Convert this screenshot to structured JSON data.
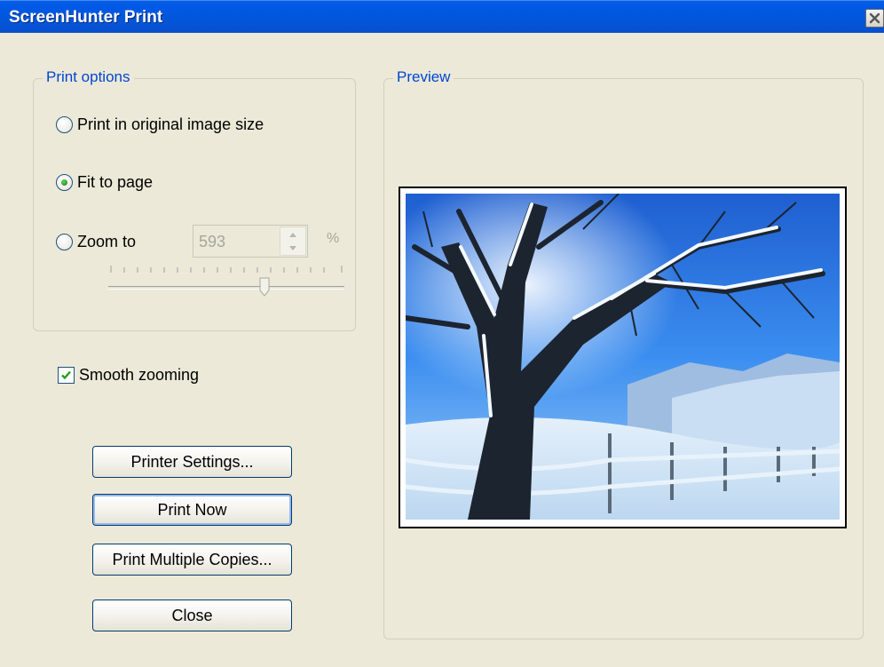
{
  "window": {
    "title": "ScreenHunter Print"
  },
  "print_options": {
    "legend": "Print options",
    "options": [
      {
        "label": "Print in original image size",
        "checked": false
      },
      {
        "label": "Fit to page",
        "checked": true
      },
      {
        "label": "Zoom to",
        "checked": false
      }
    ],
    "zoom_value": "593",
    "zoom_unit": "%",
    "zoom_slider_level": 0.7
  },
  "smooth_zooming": {
    "label": "Smooth zooming",
    "checked": true
  },
  "buttons": {
    "printer_settings": "Printer Settings...",
    "print_now": "Print Now",
    "print_multiple": "Print Multiple Copies...",
    "close": "Close"
  },
  "preview": {
    "legend": "Preview"
  },
  "colors": {
    "titlebar": "#0058e6",
    "dialog_bg": "#ece9d8",
    "group_label": "#0046d5"
  }
}
